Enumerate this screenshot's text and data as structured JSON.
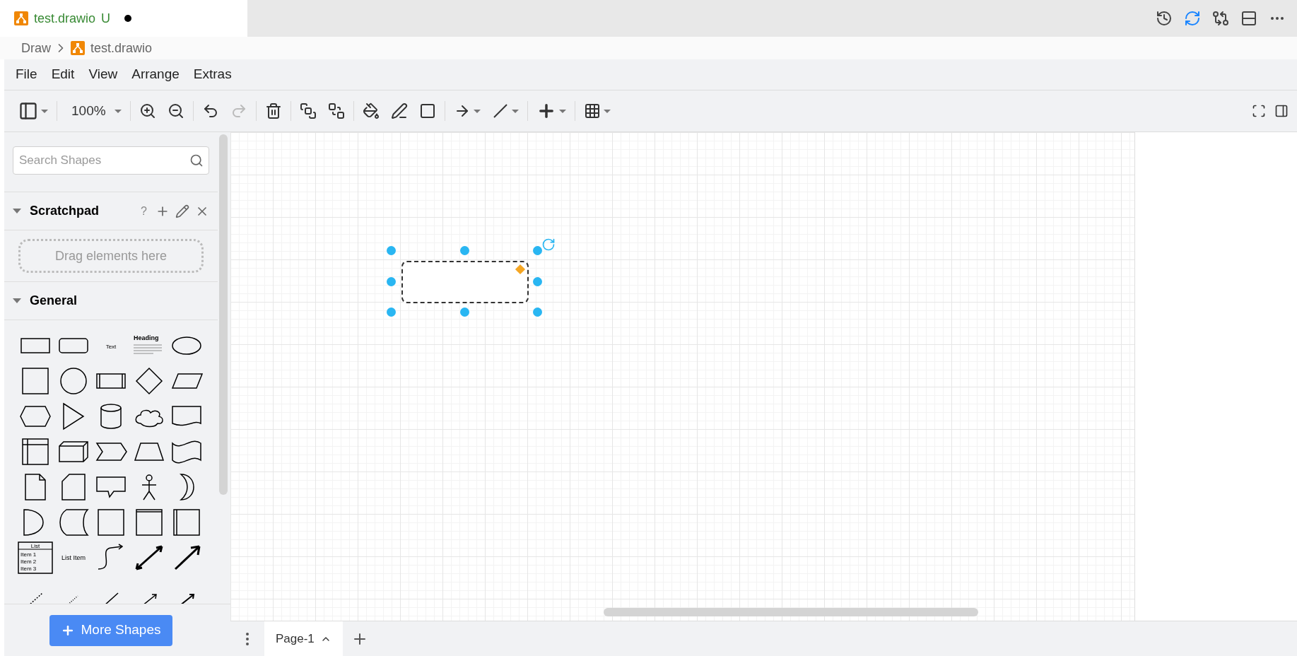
{
  "editor_tab": {
    "title": "test.drawio",
    "status": "U",
    "modified": true
  },
  "breadcrumb": [
    "Draw",
    "test.drawio"
  ],
  "menu": [
    "File",
    "Edit",
    "View",
    "Arrange",
    "Extras"
  ],
  "toolbar": {
    "zoom": "100%"
  },
  "sidebar": {
    "search": {
      "placeholder": "Search Shapes"
    },
    "scratchpad": {
      "title": "Scratchpad",
      "expanded": true,
      "help": "?",
      "hint": "Drag elements here"
    },
    "general": {
      "title": "General",
      "expanded": true
    },
    "shape_texts": {
      "text": "Text",
      "heading": "Heading",
      "list": "List",
      "list_items": [
        "Item 1",
        "Item 2",
        "Item 3"
      ],
      "list_item": "List Item"
    },
    "more_button": "More Shapes"
  },
  "pages": [
    {
      "label": "Page-1",
      "selected": true
    }
  ]
}
